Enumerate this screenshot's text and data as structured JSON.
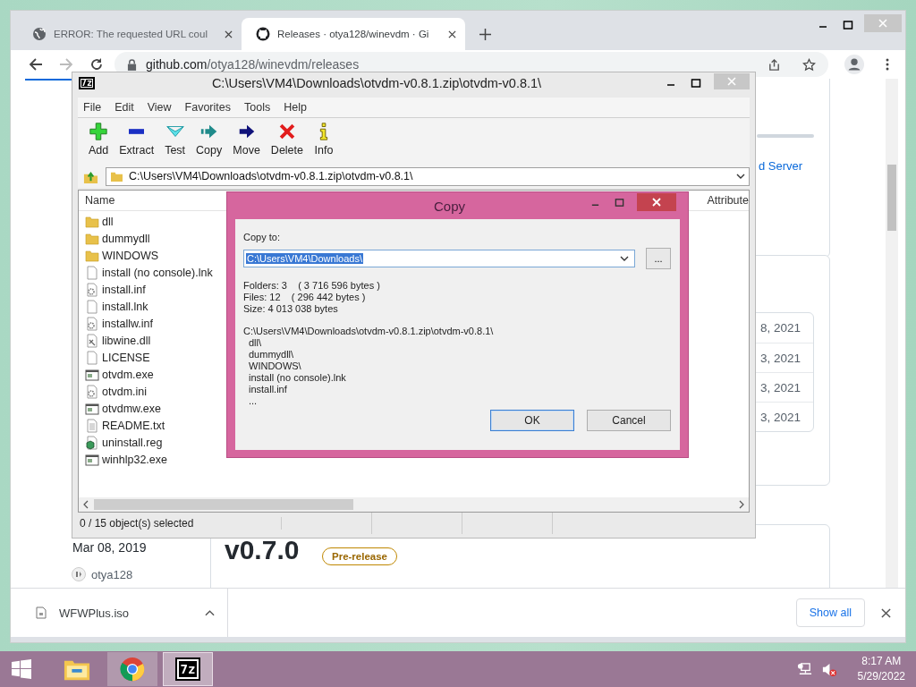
{
  "browser": {
    "tabs": [
      {
        "title": "ERROR: The requested URL coul",
        "kind": "globe",
        "selected": false
      },
      {
        "title": "Releases · otya128/winevdm · Gi",
        "kind": "repo",
        "selected": true
      }
    ],
    "url_host": "github.com",
    "url_path": "/otya128/winevdm/releases"
  },
  "page": {
    "link_fragment": "d Server",
    "dates": [
      "8, 2021",
      "3, 2021",
      "3, 2021",
      "3, 2021"
    ],
    "release": {
      "date": "Mar 08, 2019",
      "author": "otya128",
      "version": "v0.7.0",
      "badge": "Pre-release"
    }
  },
  "downloads": {
    "file": "WFWPlus.iso",
    "button": "Show all"
  },
  "sevenzip": {
    "icon_text": "7z",
    "title": "C:\\Users\\VM4\\Downloads\\otvdm-v0.8.1.zip\\otvdm-v0.8.1\\",
    "menu": [
      "File",
      "Edit",
      "View",
      "Favorites",
      "Tools",
      "Help"
    ],
    "toolbar": [
      {
        "label": "Add",
        "kind": "add"
      },
      {
        "label": "Extract",
        "kind": "extract"
      },
      {
        "label": "Test",
        "kind": "test"
      },
      {
        "label": "Copy",
        "kind": "copy"
      },
      {
        "label": "Move",
        "kind": "move"
      },
      {
        "label": "Delete",
        "kind": "delete"
      },
      {
        "label": "Info",
        "kind": "info"
      }
    ],
    "path": "C:\\Users\\VM4\\Downloads\\otvdm-v0.8.1.zip\\otvdm-v0.8.1\\",
    "columns": [
      "Name",
      "Attribute"
    ],
    "files": [
      {
        "name": "dll",
        "kind": "folder"
      },
      {
        "name": "dummydll",
        "kind": "folder"
      },
      {
        "name": "WINDOWS",
        "kind": "folder"
      },
      {
        "name": "install (no console).lnk",
        "kind": "file"
      },
      {
        "name": "install.inf",
        "kind": "settings"
      },
      {
        "name": "install.lnk",
        "kind": "file"
      },
      {
        "name": "installw.inf",
        "kind": "settings"
      },
      {
        "name": "libwine.dll",
        "kind": "library"
      },
      {
        "name": "LICENSE",
        "kind": "file"
      },
      {
        "name": "otvdm.exe",
        "kind": "program"
      },
      {
        "name": "otvdm.ini",
        "kind": "settings"
      },
      {
        "name": "otvdmw.exe",
        "kind": "program"
      },
      {
        "name": "README.txt",
        "kind": "text"
      },
      {
        "name": "uninstall.reg",
        "kind": "registry"
      },
      {
        "name": "winhlp32.exe",
        "kind": "program"
      }
    ],
    "status": "0 / 15 object(s) selected"
  },
  "dialog": {
    "title": "Copy",
    "label": "Copy to:",
    "destination": "C:\\Users\\VM4\\Downloads\\",
    "browse": "...",
    "info": [
      "Folders: 3    ( 3 716 596 bytes )",
      "Files: 12    ( 296 442 bytes )",
      "Size: 4 013 038 bytes"
    ],
    "listing": {
      "path": "C:\\Users\\VM4\\Downloads\\otvdm-v0.8.1.zip\\otvdm-v0.8.1\\",
      "items": [
        "dll\\",
        "dummydll\\",
        "WINDOWS\\",
        "install (no console).lnk",
        "install.inf",
        "..."
      ]
    },
    "buttons": [
      {
        "label": "OK",
        "selected": true
      },
      {
        "label": "Cancel",
        "selected": false
      }
    ]
  },
  "taskbar": {
    "apps": [
      {
        "kind": "explorer",
        "running": false,
        "selected": false
      },
      {
        "kind": "chrome",
        "running": true,
        "selected": false
      },
      {
        "kind": "archiver",
        "running": true,
        "selected": true,
        "icon_text": "7z"
      }
    ],
    "time": "8:17 AM",
    "date": "5/29/2022"
  }
}
